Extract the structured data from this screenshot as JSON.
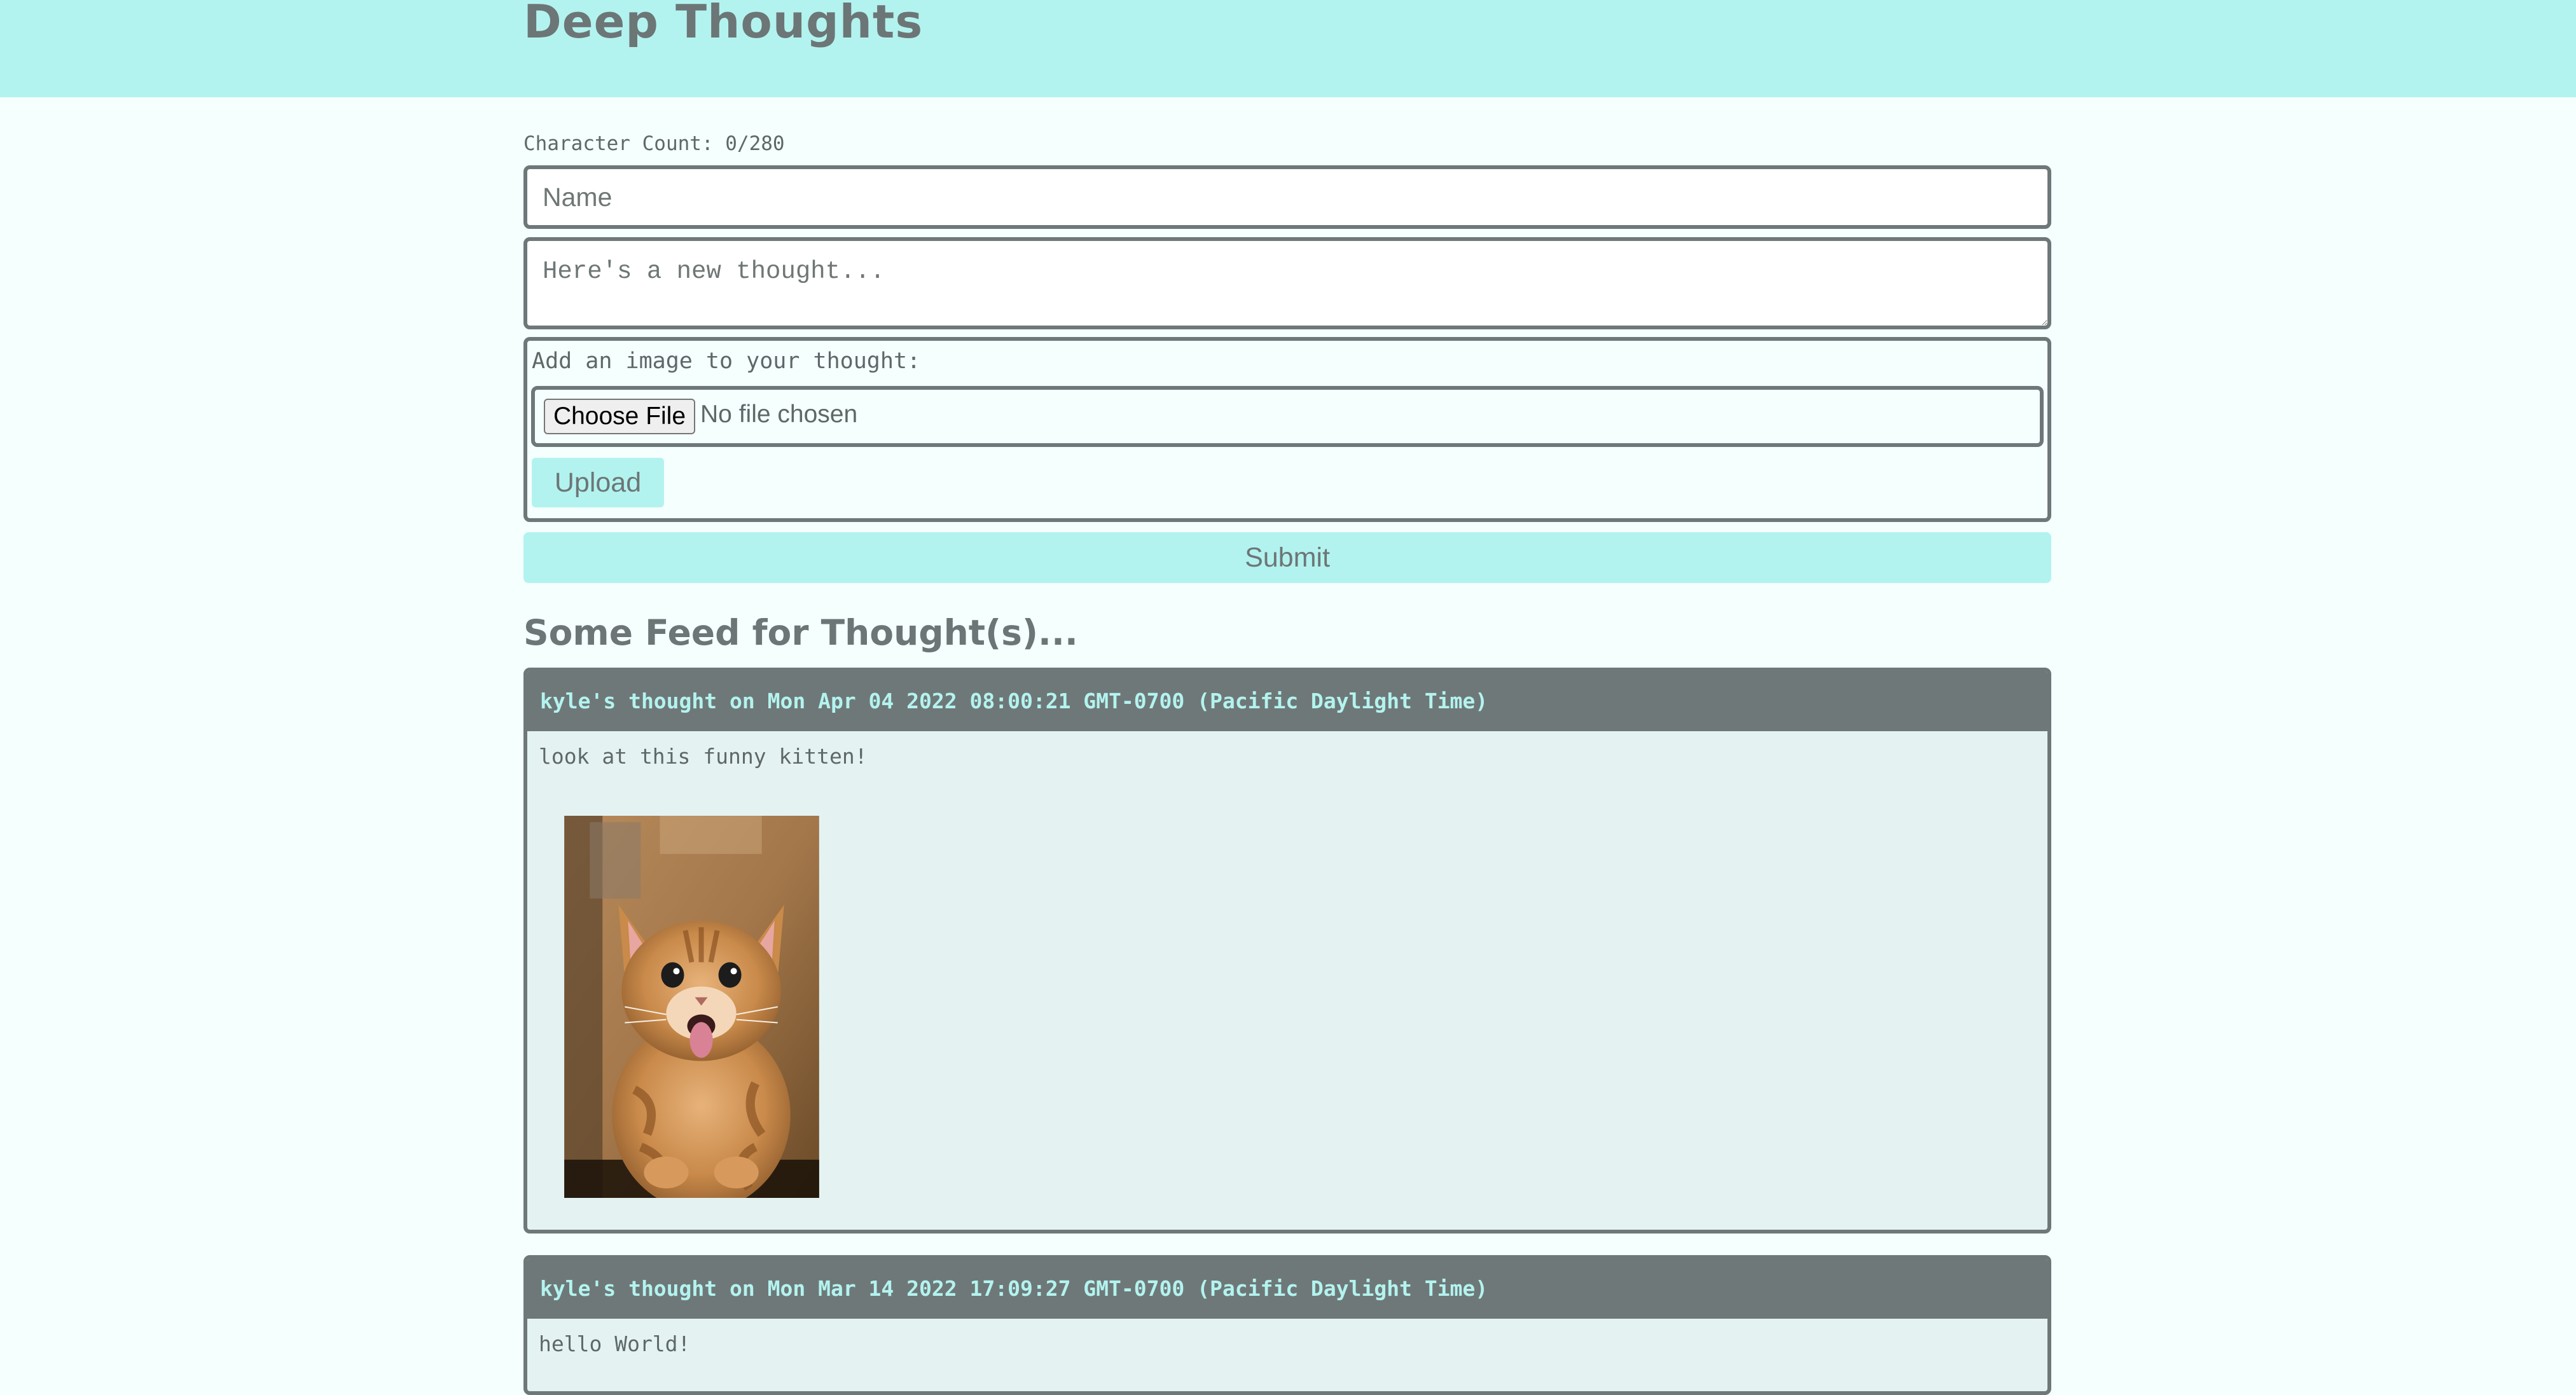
{
  "header": {
    "title": "Deep Thoughts"
  },
  "form": {
    "character_count": "Character Count: 0/280",
    "name_placeholder": "Name",
    "thought_placeholder": "Here's a new thought...",
    "image_label": "Add an image to your thought:",
    "choose_file_label": "Choose File",
    "no_file_text": "No file chosen",
    "upload_label": "Upload",
    "submit_label": "Submit"
  },
  "feed": {
    "title": "Some Feed for Thought(s)...",
    "thoughts": [
      {
        "header": "kyle's thought on Mon Apr 04 2022 08:00:21 GMT-0700 (Pacific Daylight Time)",
        "text": "look at this funny kitten!",
        "image": "kitten-photo"
      },
      {
        "header": "kyle's thought on Mon Mar 14 2022 17:09:27 GMT-0700 (Pacific Daylight Time)",
        "text": "hello World!"
      }
    ]
  },
  "colors": {
    "accent": "#b3f3ef",
    "card_header": "#6f7878",
    "card_body": "#e4f3f2",
    "page_bg": "#f5fffe"
  }
}
